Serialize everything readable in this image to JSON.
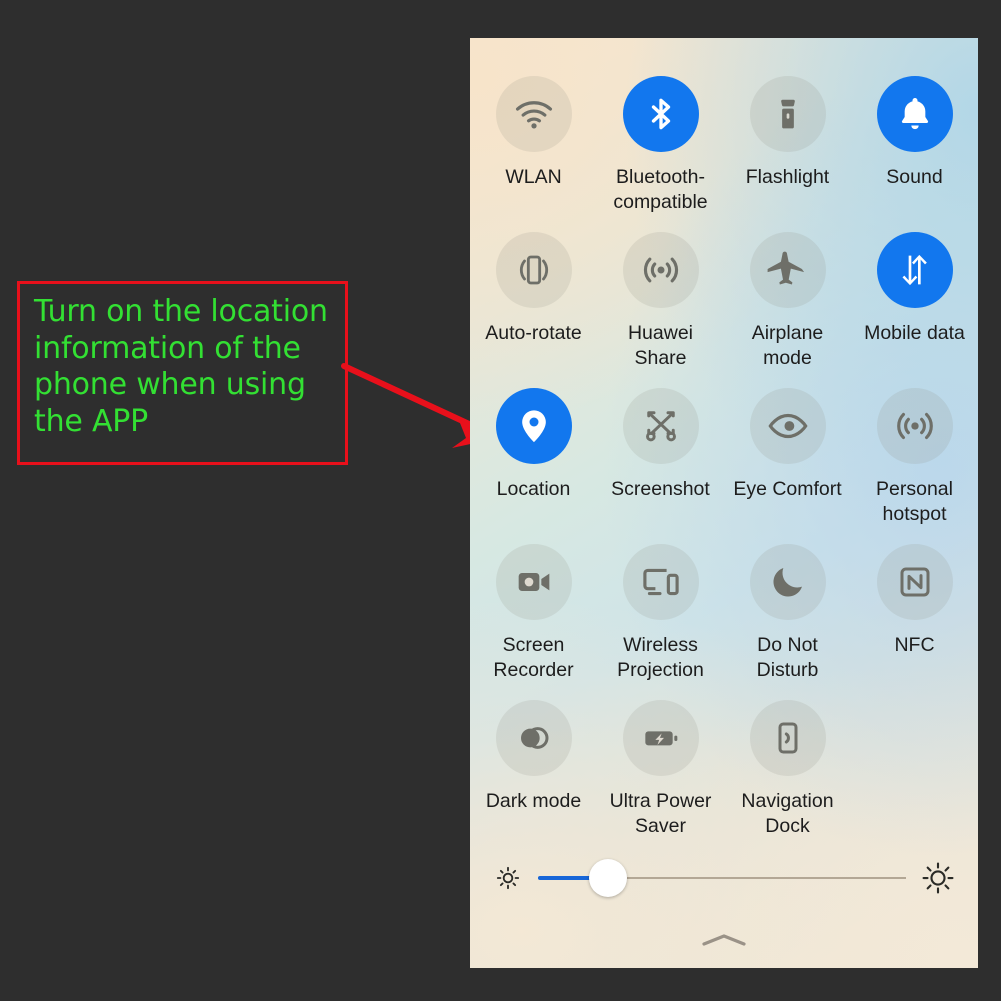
{
  "background_color": "#2e2e2e",
  "annotation": {
    "text": "Turn on the location\ninformation of the\nphone when using\nthe APP",
    "text_color": "#33e033",
    "border_color": "#e8101b",
    "arrow_color": "#e8101b",
    "arrow_target": "location-tile"
  },
  "control_panel": {
    "accent_on_color": "#1277ee",
    "tile_off_color": "rgba(140,140,130,0.17)",
    "tiles": [
      {
        "label": "WLAN",
        "icon": "wifi-icon",
        "state": "off"
      },
      {
        "label": "Bluetooth-\ncompatible",
        "icon": "bluetooth-icon",
        "state": "on"
      },
      {
        "label": "Flashlight",
        "icon": "flashlight-icon",
        "state": "off"
      },
      {
        "label": "Sound",
        "icon": "bell-icon",
        "state": "on"
      },
      {
        "label": "Auto-rotate",
        "icon": "auto-rotate-icon",
        "state": "off"
      },
      {
        "label": "Huawei Share",
        "icon": "huawei-share-icon",
        "state": "off"
      },
      {
        "label": "Airplane\nmode",
        "icon": "airplane-icon",
        "state": "off"
      },
      {
        "label": "Mobile data",
        "icon": "mobile-data-icon",
        "state": "on"
      },
      {
        "label": "Location",
        "icon": "location-pin-icon",
        "state": "on"
      },
      {
        "label": "Screenshot",
        "icon": "screenshot-scissors-icon",
        "state": "off"
      },
      {
        "label": "Eye Comfort",
        "icon": "eye-icon",
        "state": "off"
      },
      {
        "label": "Personal\nhotspot",
        "icon": "hotspot-icon",
        "state": "off"
      },
      {
        "label": "Screen\nRecorder",
        "icon": "video-camera-icon",
        "state": "off"
      },
      {
        "label": "Wireless\nProjection",
        "icon": "cast-screen-icon",
        "state": "off"
      },
      {
        "label": "Do Not\nDisturb",
        "icon": "moon-icon",
        "state": "off"
      },
      {
        "label": "NFC",
        "icon": "nfc-icon",
        "state": "off"
      },
      {
        "label": "Dark mode",
        "icon": "dark-mode-icon",
        "state": "off"
      },
      {
        "label": "Ultra Power\nSaver",
        "icon": "battery-bolt-icon",
        "state": "off"
      },
      {
        "label": "Navigation\nDock",
        "icon": "navigation-dock-icon",
        "state": "off"
      }
    ],
    "brightness": {
      "value_percent": 19,
      "fill_color": "#1766d8",
      "left_icon": "sun-small-icon",
      "right_icon": "sun-large-icon"
    },
    "collapse_handle_icon": "chevron-up-icon"
  }
}
